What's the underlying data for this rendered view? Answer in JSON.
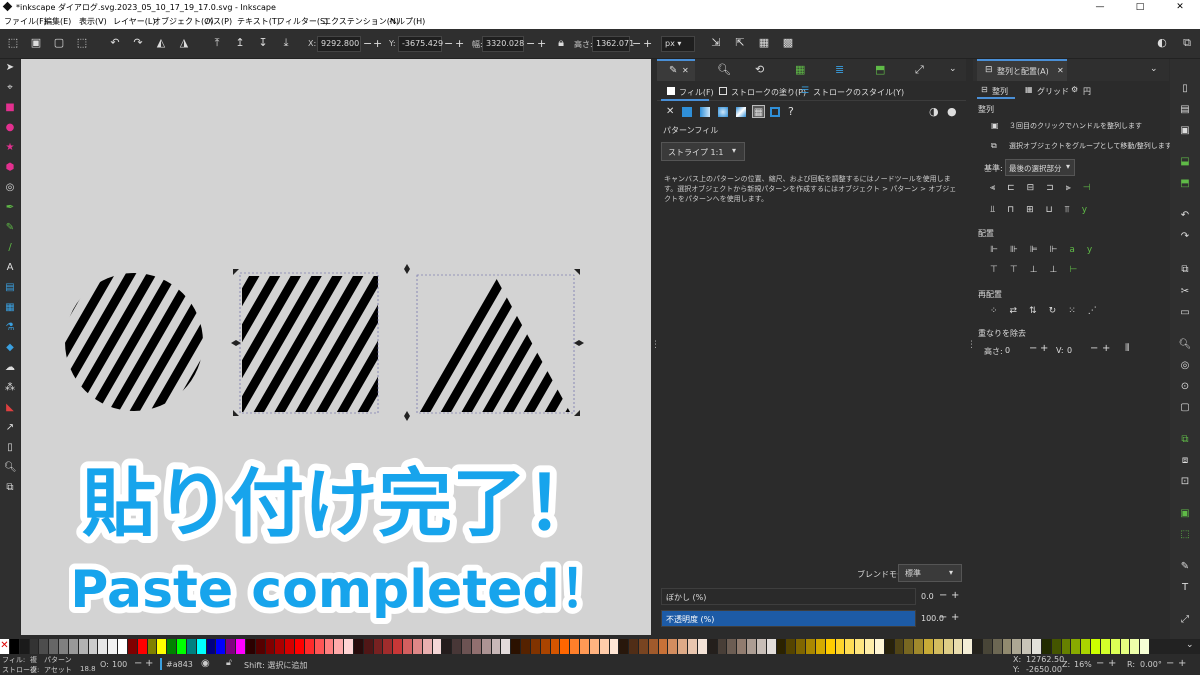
{
  "window": {
    "title": "*inkscape ダイアログ.svg.2023_05_10_17_19_17.0.svg - Inkscape",
    "minimize": "—",
    "maximize": "□",
    "close": "✕"
  },
  "menu": [
    "ファイル(F)",
    "編集(E)",
    "表示(V)",
    "レイヤー(L)",
    "オブジェクト(O)",
    "パス(P)",
    "テキスト(T)",
    "フィルター(S)",
    "エクステンション(N)",
    "ヘルプ(H)"
  ],
  "toolbar": {
    "x_label": "X:",
    "x_value": "9292.800",
    "y_label": "Y:",
    "y_value": "-3675.429",
    "w_label": "幅:",
    "w_value": "3320.028",
    "h_label": "高さ:",
    "h_value": "1362.071",
    "unit": "px"
  },
  "overlay": {
    "line1": "貼り付け完了！",
    "line2": "Paste completed！"
  },
  "fill_panel": {
    "tabs": [
      "フィル(F)",
      "ストロークの塗り(P)",
      "ストロークのスタイル(Y)"
    ],
    "section": "パターンフィル",
    "pattern": "ストライプ 1:1",
    "help": "キャンバス上のパターンの位置、縮尺、および回転を調整するにはノードツールを使用します。選択オブジェクトから新規パターンを作成するにはオブジェクト > パターン > オブジェクトをパターンへを使用します。",
    "blend_label": "ブレンドモード:",
    "blend_value": "標準",
    "blur_label": "ぼかし (%)",
    "blur_value": "0.0",
    "opacity_label": "不透明度 (%)",
    "opacity_value": "100.0",
    "opacity_level": 1.0
  },
  "align_panel": {
    "tab": "整列と配置(A)",
    "subtabs": [
      "整列",
      "グリッド",
      "円"
    ],
    "align_heading": "整列",
    "opt1": "３回目のクリックでハンドルを整列します",
    "opt2": "選択オブジェクトをグループとして移動/整列します",
    "relative_label": "基準:",
    "relative_value": "最後の選択部分",
    "distribute": "配置",
    "rearrange": "再配置",
    "remove_overlap": "重なりを除去",
    "h_label": "高さ:",
    "h_value": "0",
    "v_label": "V:",
    "v_value": "0"
  },
  "status": {
    "fill_label": "フィル:",
    "fill_value": "複",
    "fill_kind": "パターン",
    "stroke_label": "ストローク:",
    "stroke_value": "複",
    "stroke_kind": "アセット",
    "stroke_width": "18.8",
    "opacity_label": "O:",
    "opacity_value": "100",
    "layer": "#a843",
    "message": "Shift: 選択に追加",
    "x_label": "X:",
    "x_value": "12762.50",
    "y_label": "Y:",
    "y_value": "-2650.00",
    "zoom_label": "Z:",
    "zoom_value": "16%",
    "rot_label": "R:",
    "rot_value": "0.00°"
  },
  "palette": [
    "#000000",
    "#1a1a1a",
    "#333333",
    "#4d4d4d",
    "#666666",
    "#808080",
    "#999999",
    "#b3b3b3",
    "#cccccc",
    "#e6e6e6",
    "#f2f2f2",
    "#ffffff",
    "#800000",
    "#ff0000",
    "#808000",
    "#ffff00",
    "#008000",
    "#00ff00",
    "#008080",
    "#00ffff",
    "#000080",
    "#0000ff",
    "#800080",
    "#ff00ff",
    "#2b0000",
    "#550000",
    "#800000",
    "#aa0000",
    "#d40000",
    "#ff0000",
    "#ff2a2a",
    "#ff5555",
    "#ff8080",
    "#ffaaaa",
    "#ffd5d5",
    "#280b0b",
    "#501616",
    "#782121",
    "#a02c2c",
    "#c83737",
    "#d35f5f",
    "#de8787",
    "#e9afaf",
    "#f4d7d7",
    "#241c1c",
    "#483737",
    "#6c5353",
    "#916f6f",
    "#ac9393",
    "#c8b7b7",
    "#e3dbdb",
    "#2b1100",
    "#552200",
    "#803300",
    "#aa4400",
    "#d45500",
    "#ff6600",
    "#ff7f2a",
    "#ff9955",
    "#ffb380",
    "#ffccaa",
    "#ffe6d5",
    "#28170b",
    "#502d16",
    "#784421",
    "#a05a2c",
    "#c87137",
    "#d38d5f",
    "#deaa87",
    "#e9c6af",
    "#f4e3d7",
    "#241f1c",
    "#483e37",
    "#6c5d53",
    "#917c6f",
    "#ac9d93",
    "#c8beb7",
    "#e3dedb",
    "#2b2200",
    "#554400",
    "#806600",
    "#aa8800",
    "#d4aa00",
    "#ffcc00",
    "#ffd42a",
    "#ffdd55",
    "#ffe680",
    "#ffeeaa",
    "#fff6d5",
    "#28220b",
    "#504416",
    "#786721",
    "#a0892c",
    "#c8ab37",
    "#d3bc5f",
    "#decd87",
    "#e9ddaf",
    "#f4eed7",
    "#24221c",
    "#484537",
    "#6c6753",
    "#918a6f",
    "#aca793",
    "#c8c4b7",
    "#e3e2db",
    "#222b00",
    "#445500",
    "#668000",
    "#88aa00",
    "#aad400",
    "#ccff00",
    "#d4ff2a",
    "#ddff55",
    "#e5ff80",
    "#eeffaa",
    "#f6ffd5"
  ]
}
